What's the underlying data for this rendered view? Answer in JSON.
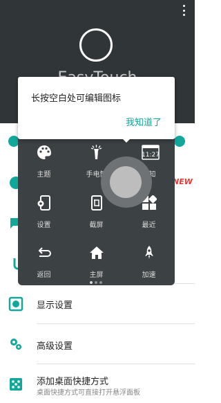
{
  "header": {
    "app_name": "EasyTouch",
    "more_icon": "more-vert-icon"
  },
  "colors": {
    "accent": "#12a79b",
    "header_bg": "#303638",
    "panel_bg": "#3c4143",
    "badge": "#e53935"
  },
  "panel": {
    "page_count": 3,
    "active_page": 1,
    "items": [
      {
        "label": "主题",
        "icon": "palette-icon"
      },
      {
        "label": "手电筒",
        "icon": "flashlight-icon"
      },
      {
        "label": "通知",
        "icon": "notification-icon",
        "clock": "11:27"
      },
      {
        "label": "设置",
        "icon": "settings-phone-icon"
      },
      {
        "label": "截屏",
        "icon": "screenshot-icon"
      },
      {
        "label": "最近",
        "icon": "recent-apps-icon"
      },
      {
        "label": "返回",
        "icon": "back-icon"
      },
      {
        "label": "主屏",
        "icon": "home-icon"
      },
      {
        "label": "加速",
        "icon": "rocket-icon"
      }
    ]
  },
  "tooltip": {
    "text": "长按空白处可编辑图标",
    "button": "我知道了"
  },
  "list": {
    "new_badge": "NEW",
    "items": [
      {
        "label": "显示设置",
        "icon": "display-settings-icon"
      },
      {
        "label": "高级设置",
        "icon": "advanced-settings-icon"
      },
      {
        "label": "添加桌面快捷方式",
        "sub": "桌面快捷方式可直接打开悬浮面板",
        "icon": "shortcut-icon"
      }
    ]
  }
}
